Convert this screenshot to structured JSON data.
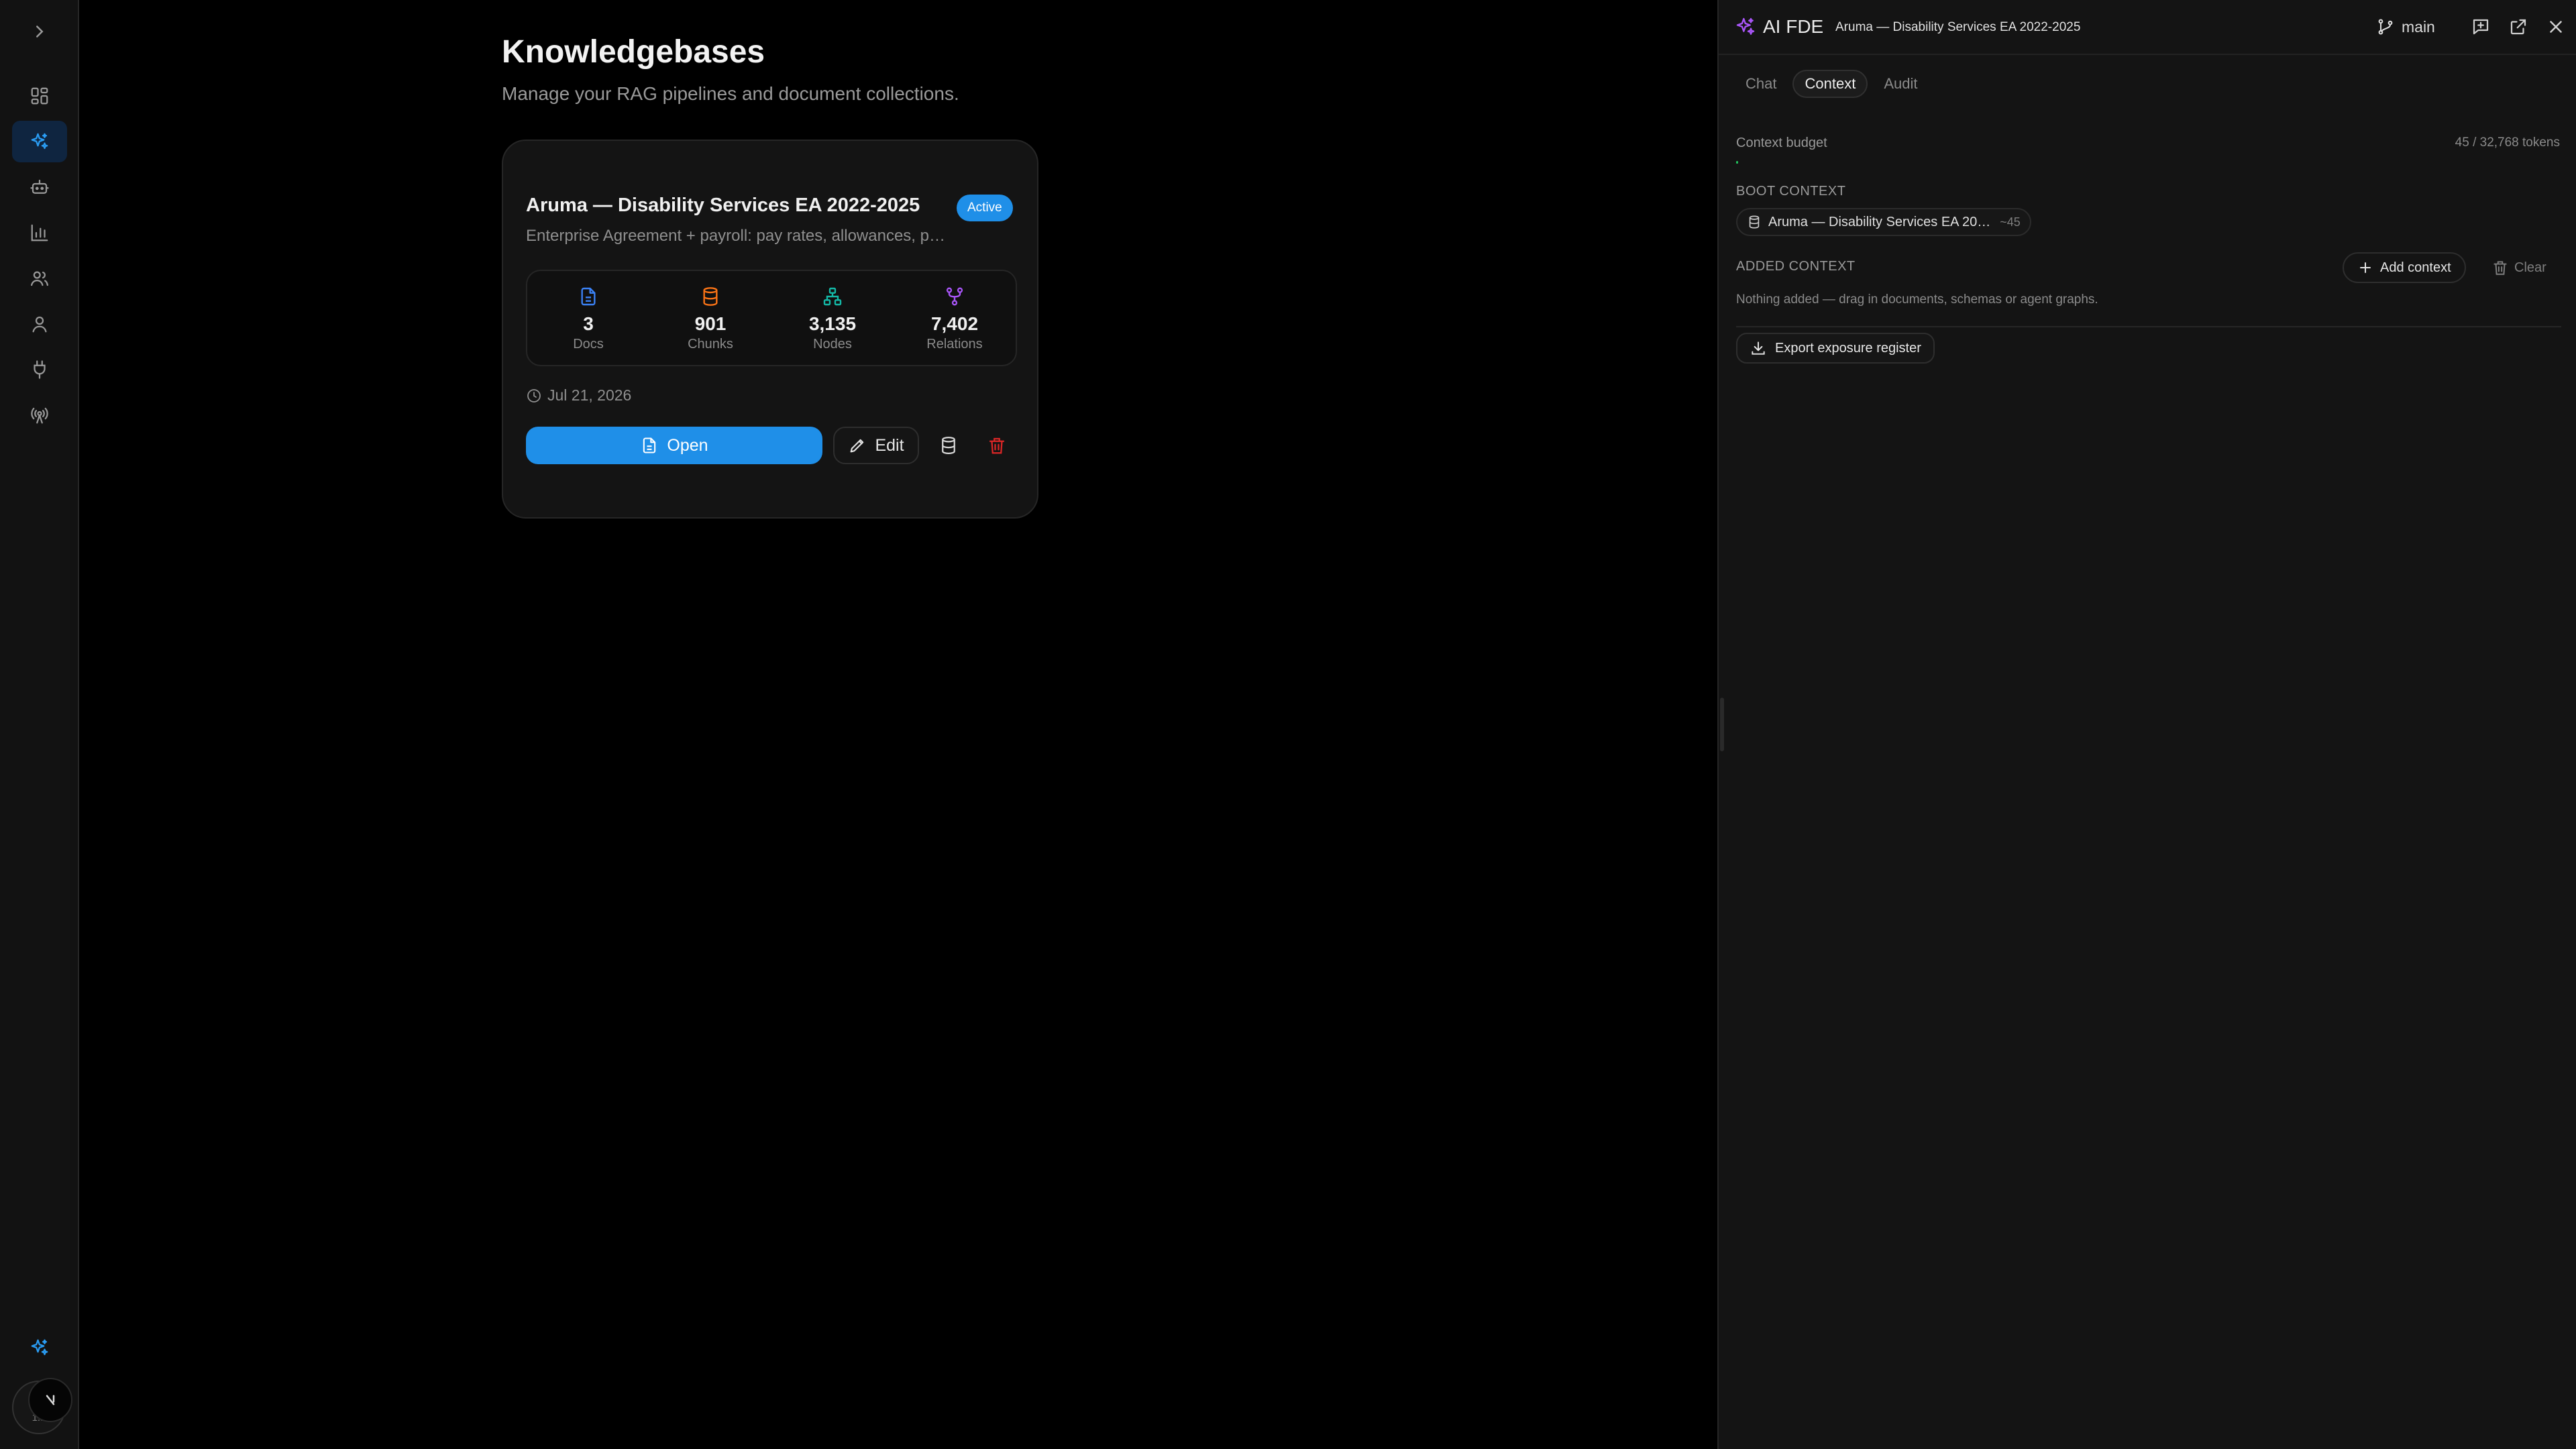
{
  "colors": {
    "accent": "#1f8fe8",
    "docs": "#3b82f6",
    "chunks": "#f97316",
    "nodes": "#14b8a6",
    "relations": "#a855f7",
    "danger": "#dc2626",
    "budget": "#22c55e"
  },
  "sidebar": {
    "items": [
      {
        "icon": "chevron-right-icon"
      },
      {
        "icon": "dashboard-grid-icon"
      },
      {
        "icon": "sparkles-icon",
        "active": true
      },
      {
        "icon": "bot-icon"
      },
      {
        "icon": "bar-chart-icon"
      },
      {
        "icon": "users-icon"
      },
      {
        "icon": "user-icon"
      },
      {
        "icon": "plug-icon"
      },
      {
        "icon": "broadcast-icon"
      }
    ],
    "bottom": {
      "icon": "sparkles-icon"
    },
    "avatar_label": "1...",
    "avatar_badge_icon": "n-logo-icon"
  },
  "main": {
    "title": "Knowledgebases",
    "subtitle": "Manage your RAG pipelines and document collections.",
    "card": {
      "name": "Aruma — Disability Services EA 2022-2025",
      "badge": "Active",
      "description": "Enterprise Agreement + payroll: pay rates, allowances, p…",
      "stats": [
        {
          "icon": "document-icon",
          "value": "3",
          "label": "Docs"
        },
        {
          "icon": "database-icon",
          "value": "901",
          "label": "Chunks"
        },
        {
          "icon": "network-icon",
          "value": "3,135",
          "label": "Nodes"
        },
        {
          "icon": "fork-icon",
          "value": "7,402",
          "label": "Relations"
        }
      ],
      "date": "Jul 21, 2026",
      "open_label": "Open",
      "edit_label": "Edit"
    }
  },
  "panel": {
    "title": "AI FDE",
    "context_chip": "Aruma — Disability Services EA 2022-2025",
    "branch": "main",
    "tabs": [
      {
        "label": "Chat",
        "active": false
      },
      {
        "label": "Context",
        "active": true
      },
      {
        "label": "Audit",
        "active": false
      }
    ],
    "budget_label": "Context budget",
    "budget_value": "45 / 32,768 tokens",
    "budget_fraction": 0.0014,
    "boot_label": "BOOT CONTEXT",
    "boot_item": {
      "name": "Aruma — Disability Services EA 20…",
      "tokens": "~45"
    },
    "added_label": "ADDED CONTEXT",
    "add_label": "Add context",
    "clear_label": "Clear",
    "empty_note": "Nothing added — drag in documents, schemas or agent graphs.",
    "export_label": "Export exposure register"
  }
}
